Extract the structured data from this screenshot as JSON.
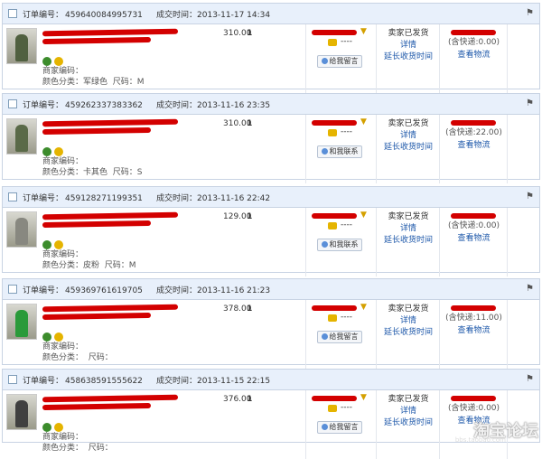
{
  "labels": {
    "order_no": "订单编号：",
    "deal_time": "成交时间：",
    "merchant_code": "商家编码：",
    "color": "颜色分类：",
    "size": "尺码：",
    "leave_msg": "给我留言",
    "contact_me": "和我联系",
    "status": "卖家已发货",
    "details": "详情",
    "extend": "延长收货时间",
    "view_logistics": "查看物流",
    "dash": "----"
  },
  "orders": [
    {
      "order_no": "459640084995731",
      "time": "2013-11-17 14:34",
      "price": "310.00",
      "qty": "1",
      "color": "军绿色",
      "size": "M",
      "shipping": "(含快递:0.00)",
      "btn": "给我留言",
      "thumb": "#506040"
    },
    {
      "order_no": "459262337383362",
      "time": "2013-11-16 23:35",
      "price": "310.00",
      "qty": "1",
      "color": "卡其色",
      "size": "S",
      "shipping": "(含快递:22.00)",
      "btn": "和我联系",
      "thumb": "#5a6a48"
    },
    {
      "order_no": "459128271199351",
      "time": "2013-11-16 22:42",
      "price": "129.00",
      "qty": "1",
      "color": "皮粉",
      "size": "M",
      "shipping": "(含快递:0.00)",
      "btn": "和我联系",
      "thumb": "#888880"
    },
    {
      "order_no": "459369761619705",
      "time": "2013-11-16 21:23",
      "price": "378.00",
      "qty": "1",
      "color": "",
      "size": "",
      "shipping": "(含快递:11.00)",
      "btn": "给我留言",
      "thumb": "#2a9a3a"
    },
    {
      "order_no": "458638591555622",
      "time": "2013-11-15 22:15",
      "price": "376.00",
      "qty": "1",
      "color": "",
      "size": "",
      "shipping": "(含快递:0.00)",
      "btn": "给我留言",
      "thumb": "#404040"
    }
  ],
  "watermark": {
    "text": "淘宝论坛",
    "sub": "bbs.taobao.com"
  }
}
